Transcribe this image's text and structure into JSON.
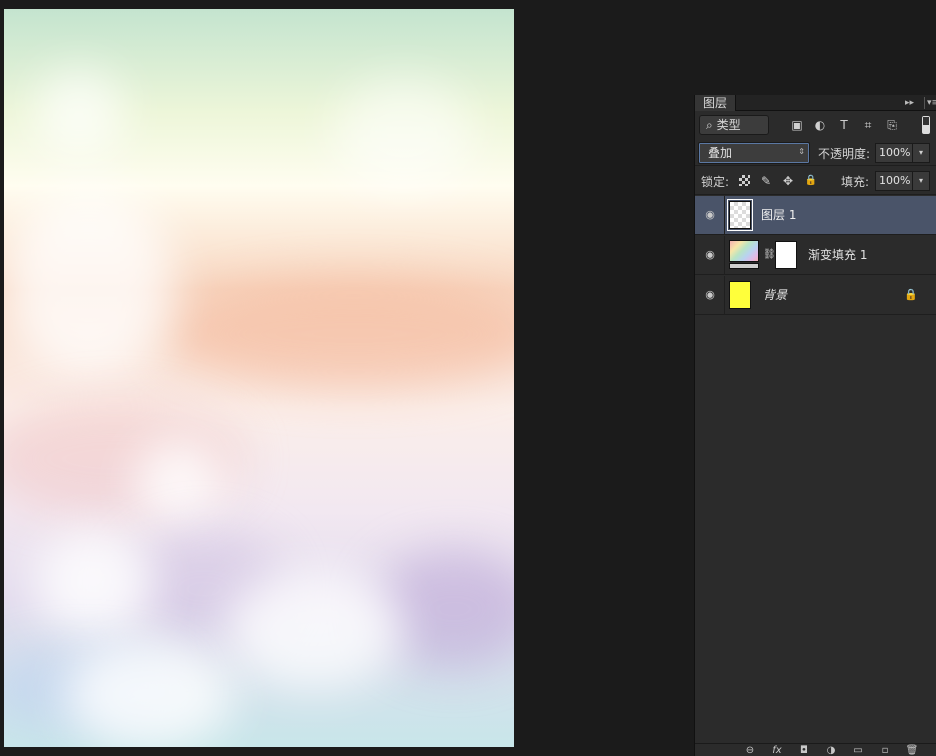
{
  "panel": {
    "tab_label": "图层",
    "collapse_glyph": "▸▸",
    "menu_glyph": "▾≡",
    "filter": {
      "kind_label": "类型",
      "search_glyph": "⌕",
      "spinner_glyph": "⇕",
      "icons": [
        "image-filter-icon",
        "adjustment-filter-icon",
        "type-filter-icon",
        "shape-filter-icon",
        "smart-object-filter-icon"
      ],
      "glyphs": [
        "▣",
        "◐",
        "T",
        "⌗",
        "⎘"
      ]
    },
    "blend_mode": "叠加",
    "opacity_label": "不透明度:",
    "opacity_value": "100%",
    "lock_label": "锁定:",
    "fill_label": "填充:",
    "fill_value": "100%",
    "dropdown_glyph": "▾",
    "lock_glyphs": {
      "paint": "✎",
      "move": "✥",
      "all": "🔒"
    },
    "eye_glyph": "◉",
    "chain_glyph": "⛓",
    "layers": [
      {
        "name": "图层 1",
        "selected": true
      },
      {
        "name": "渐变填充 1",
        "selected": false
      },
      {
        "name": "背景",
        "selected": false,
        "locked": true
      }
    ],
    "footer_glyphs": [
      "⊖",
      "fx",
      "◘",
      "◑",
      "▭",
      "▫",
      "🗑"
    ]
  },
  "colors": {
    "panel_bg": "#2b2b2b",
    "selected_layer": "#4a5469",
    "background_layer_fill": "#ffff3b"
  }
}
